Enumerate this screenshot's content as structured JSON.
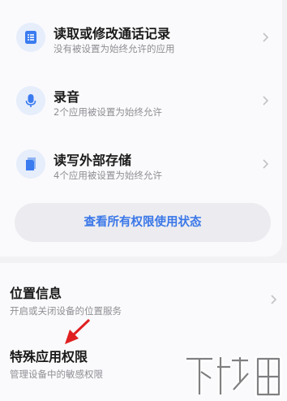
{
  "permissions": [
    {
      "icon": "call-log-icon",
      "title": "读取或修改通话记录",
      "subtitle": "没有被设置为始终允许的应用"
    },
    {
      "icon": "microphone-icon",
      "title": "录音",
      "subtitle": "2个应用被设置为始终允许"
    },
    {
      "icon": "storage-icon",
      "title": "读写外部存储",
      "subtitle": "4个应用被设置为始终允许"
    }
  ],
  "view_all_label": "查看所有权限使用状态",
  "settings": [
    {
      "title": "位置信息",
      "subtitle": "开启或关闭设备的位置服务"
    },
    {
      "title": "特殊应用权限",
      "subtitle": "管理设备中的敏感权限"
    }
  ],
  "colors": {
    "accent": "#3a77e8",
    "annotation_arrow": "#e02020",
    "icon_bg": "#e6edfb"
  },
  "watermark_text": "下载吧"
}
